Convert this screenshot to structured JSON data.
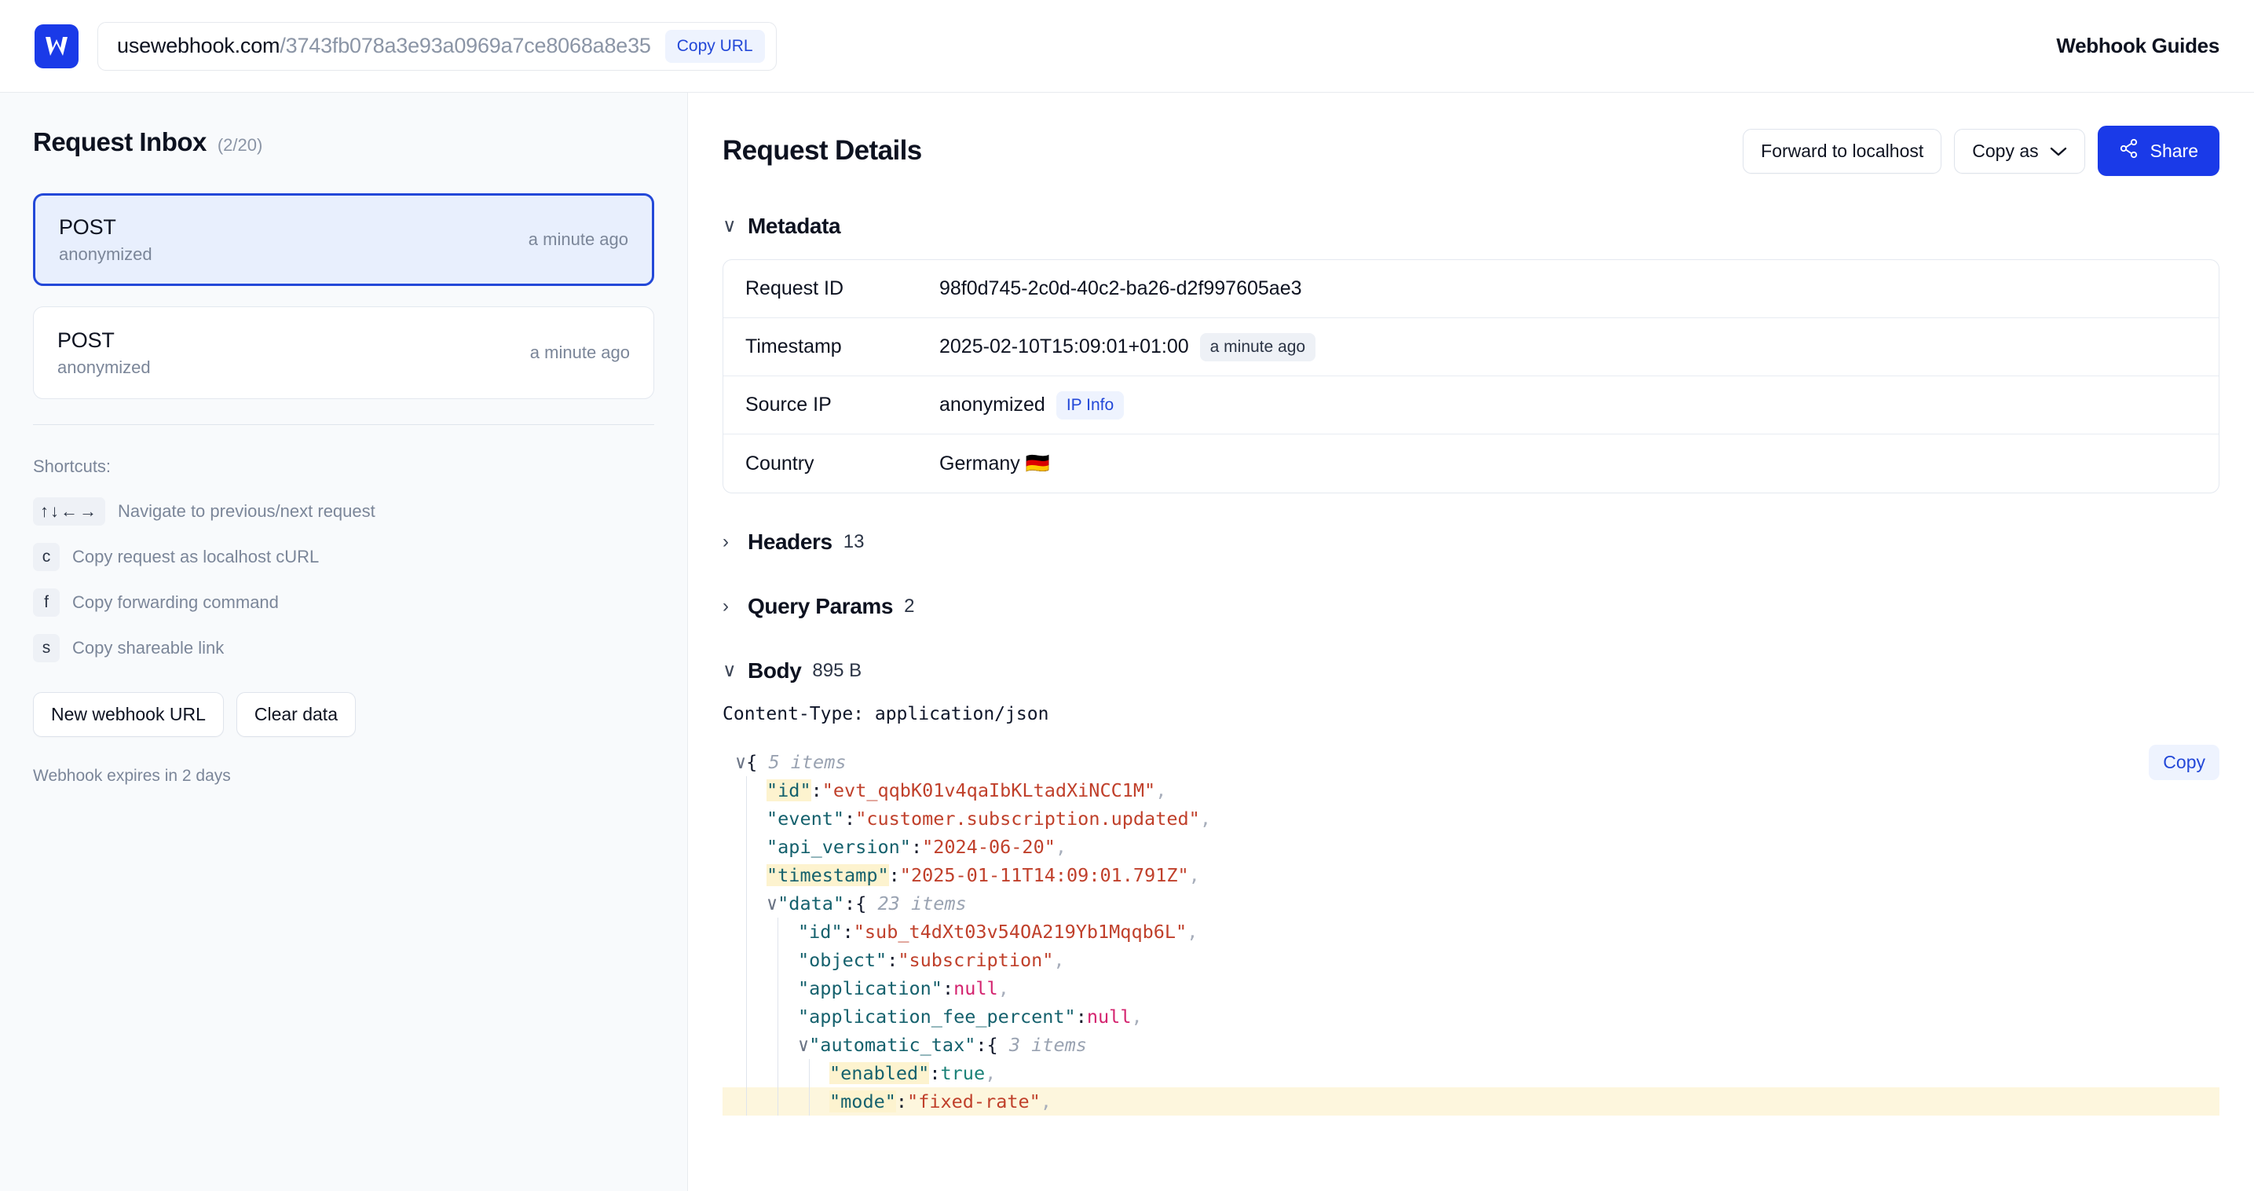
{
  "header": {
    "logo_letter": "W",
    "url_host": "usewebhook.com",
    "url_path": "/3743fb078a3e93a0969a7ce8068a8e35",
    "copy_url_label": "Copy URL",
    "guides_label": "Webhook Guides"
  },
  "sidebar": {
    "title": "Request Inbox",
    "count": "(2/20)",
    "requests": [
      {
        "method": "POST",
        "source": "anonymized",
        "time": "a minute ago",
        "selected": true
      },
      {
        "method": "POST",
        "source": "anonymized",
        "time": "a minute ago",
        "selected": false
      }
    ],
    "shortcuts_label": "Shortcuts:",
    "shortcuts": [
      {
        "key": "↑↓←→",
        "desc": "Navigate to previous/next request"
      },
      {
        "key": "c",
        "desc": "Copy request as localhost cURL"
      },
      {
        "key": "f",
        "desc": "Copy forwarding command"
      },
      {
        "key": "s",
        "desc": "Copy shareable link"
      }
    ],
    "new_webhook_label": "New webhook URL",
    "clear_data_label": "Clear data",
    "expires": "Webhook expires in 2 days"
  },
  "main": {
    "title": "Request Details",
    "actions": {
      "forward_label": "Forward to localhost",
      "copy_as_label": "Copy as",
      "share_label": "Share"
    },
    "metadata": {
      "section_label": "Metadata",
      "caret": "∨",
      "rows": [
        {
          "key": "Request ID",
          "value": "98f0d745-2c0d-40c2-ba26-d2f997605ae3",
          "pill": "",
          "pill_type": ""
        },
        {
          "key": "Timestamp",
          "value": "2025-02-10T15:09:01+01:00",
          "pill": "a minute ago",
          "pill_type": "gray"
        },
        {
          "key": "Source IP",
          "value": "anonymized",
          "pill": "IP Info",
          "pill_type": "blue"
        },
        {
          "key": "Country",
          "value": "Germany 🇩🇪",
          "pill": "",
          "pill_type": ""
        }
      ]
    },
    "headers_section": {
      "label": "Headers",
      "badge": "13",
      "caret": "›"
    },
    "query_section": {
      "label": "Query Params",
      "badge": "2",
      "caret": "›"
    },
    "body_section": {
      "label": "Body",
      "badge": "895 B",
      "caret": "∨"
    },
    "content_type": "Content-Type: application/json",
    "copy_label": "Copy"
  },
  "json_body": {
    "root_items": "5 items",
    "lines": [
      {
        "indent": 0,
        "twisty": "∨",
        "open_brace": "{",
        "items": "5 items"
      },
      {
        "indent": 1,
        "key": "\"id\"",
        "key_hl": true,
        "value": "\"evt_qqbK01v4qaIbKLtadXiNCC1M\"",
        "type": "str",
        "comma": true
      },
      {
        "indent": 1,
        "key": "\"event\"",
        "value": "\"customer.subscription.updated\"",
        "type": "str",
        "comma": true
      },
      {
        "indent": 1,
        "key": "\"api_version\"",
        "value": "\"2024-06-20\"",
        "type": "str",
        "comma": true
      },
      {
        "indent": 1,
        "key": "\"timestamp\"",
        "key_hl": true,
        "value": "\"2025-01-11T14:09:01.791Z\"",
        "type": "str",
        "comma": true
      },
      {
        "indent": 1,
        "twisty": "∨",
        "key": "\"data\"",
        "open_brace": "{",
        "items": "23 items"
      },
      {
        "indent": 2,
        "key": "\"id\"",
        "value": "\"sub_t4dXt03v54OA219Yb1Mqqb6L\"",
        "type": "str",
        "comma": true
      },
      {
        "indent": 2,
        "key": "\"object\"",
        "value": "\"subscription\"",
        "type": "str",
        "comma": true
      },
      {
        "indent": 2,
        "key": "\"application\"",
        "value": "null",
        "type": "null",
        "comma": true
      },
      {
        "indent": 2,
        "key": "\"application_fee_percent\"",
        "value": "null",
        "type": "null",
        "comma": true
      },
      {
        "indent": 2,
        "twisty": "∨",
        "key": "\"automatic_tax\"",
        "open_brace": "{",
        "items": "3 items"
      },
      {
        "indent": 3,
        "key": "\"enabled\"",
        "key_hl": true,
        "value": "true",
        "type": "bool",
        "comma": true
      },
      {
        "indent": 3,
        "key": "\"mode\"",
        "key_hl": true,
        "value": "\"fixed-rate\"",
        "type": "str",
        "comma": true,
        "row_hl": true
      }
    ]
  },
  "colors": {
    "brand": "#1a3ae8",
    "accent_link": "#2348d8",
    "sidebar_bg": "#f8fafc",
    "selected_bg": "#e8effd",
    "json_string": "#c0402b",
    "json_key": "#15616d",
    "json_bool": "#1a8177",
    "json_null": "#d4246f",
    "highlight": "#fdf3cf"
  }
}
